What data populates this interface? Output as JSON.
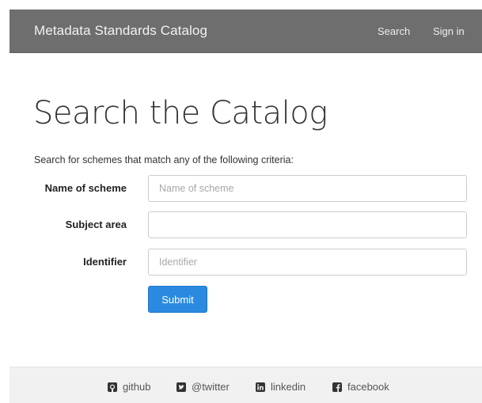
{
  "navbar": {
    "brand": "Metadata Standards Catalog",
    "links": [
      {
        "label": "Search"
      },
      {
        "label": "Sign in"
      }
    ]
  },
  "main": {
    "title": "Search the Catalog",
    "intro": "Search for schemes that match any of the following criteria:",
    "fields": [
      {
        "label": "Name of scheme",
        "placeholder": "Name of scheme",
        "value": ""
      },
      {
        "label": "Subject area",
        "placeholder": "",
        "value": ""
      },
      {
        "label": "Identifier",
        "placeholder": "Identifier",
        "value": ""
      }
    ],
    "submit_label": "Submit"
  },
  "footer": {
    "links": [
      {
        "label": "github",
        "icon": "github-icon"
      },
      {
        "label": "@twitter",
        "icon": "twitter-icon"
      },
      {
        "label": "linkedin",
        "icon": "linkedin-icon"
      },
      {
        "label": "facebook",
        "icon": "facebook-icon"
      }
    ]
  },
  "colors": {
    "navbar_bg": "#6e6e6e",
    "primary_button": "#2b8ae0",
    "footer_bg": "#f1f1f1"
  }
}
